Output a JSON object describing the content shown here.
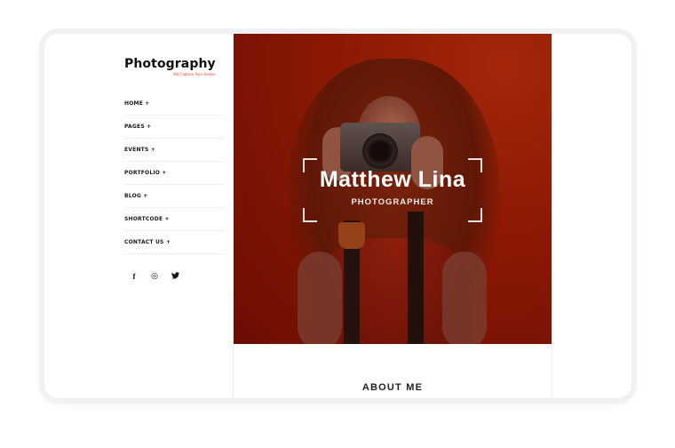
{
  "brand": {
    "title": "Photography",
    "tagline": "We Capture Your Smiles",
    "accent_color": "#e8472b"
  },
  "nav": {
    "items": [
      {
        "label": "HOME +"
      },
      {
        "label": "PAGES +"
      },
      {
        "label": "EVENTS +"
      },
      {
        "label": "PORTFOLIO +"
      },
      {
        "label": "BLOG +"
      },
      {
        "label": "SHORTCODE +"
      },
      {
        "label": "CONTACT US +"
      }
    ]
  },
  "social": {
    "facebook": "f",
    "instagram": "◎",
    "twitter": "🐦"
  },
  "hero": {
    "name": "Matthew Lina",
    "role": "PHOTOGRAPHER",
    "background_color": "#a51f07"
  },
  "about": {
    "heading": "ABOUT ME"
  }
}
